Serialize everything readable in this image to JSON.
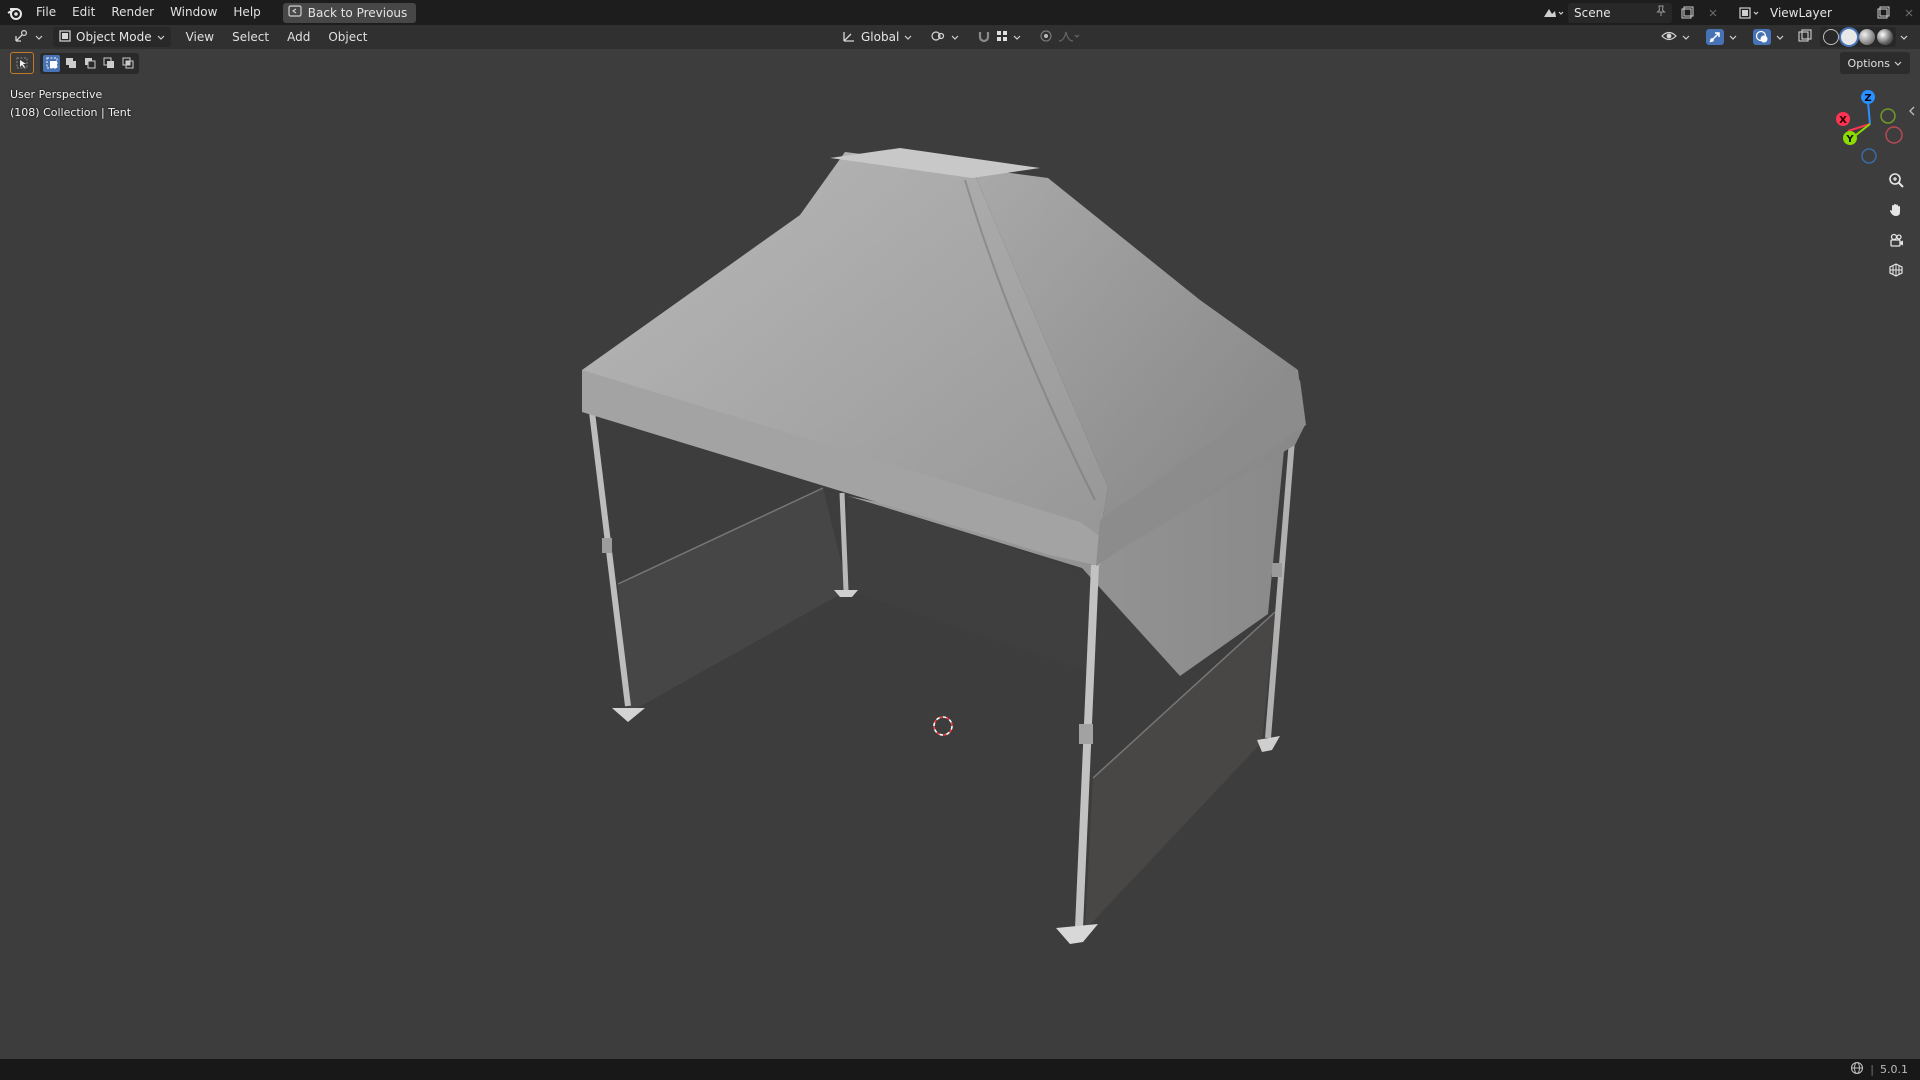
{
  "menu": {
    "items": [
      "File",
      "Edit",
      "Render",
      "Window",
      "Help"
    ],
    "back_button": "Back to Previous"
  },
  "header": {
    "scene_name": "Scene",
    "view_layer": "ViewLayer"
  },
  "toolbar": {
    "mode": "Object Mode",
    "menus": [
      "View",
      "Select",
      "Add",
      "Object"
    ],
    "transform_orientation": "Global",
    "options_label": "Options"
  },
  "viewport": {
    "perspective_label": "User Perspective",
    "collection_info": "(108) Collection | Tent"
  },
  "gizmo": {
    "x_label": "X",
    "y_label": "Y",
    "z_label": "Z"
  },
  "status": {
    "version": "5.0.1"
  },
  "colors": {
    "accent": "#4772b3",
    "x_axis": "#ff3352",
    "y_axis": "#8bdc00",
    "z_axis": "#2890ff"
  },
  "icons": [
    "blender-logo-icon",
    "back-icon",
    "editor-type-icon",
    "object-mode-icon",
    "chevron-down-icon",
    "global-icon",
    "pivot-icon",
    "snap-icon",
    "proportional-icon",
    "visibility-icon",
    "gizmo-icon",
    "overlay-icon",
    "xray-icon",
    "wireframe-shading-icon",
    "solid-shading-icon",
    "material-shading-icon",
    "rendered-shading-icon",
    "select-tool-icon",
    "zoom-icon",
    "hand-icon",
    "camera-icon",
    "grid-icon",
    "pin-icon",
    "new-scene-icon",
    "close-icon",
    "world-icon"
  ]
}
